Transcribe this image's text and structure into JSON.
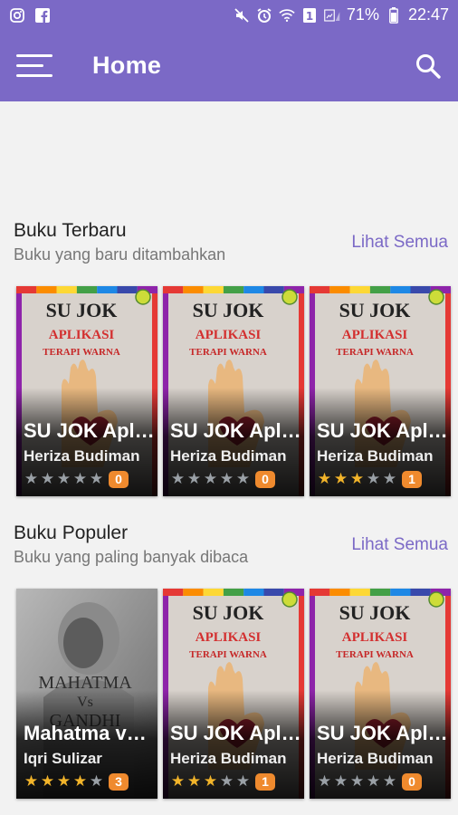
{
  "status_bar": {
    "battery": "71%",
    "time": "22:47",
    "icons": [
      "instagram-icon",
      "facebook-icon",
      "mute-icon",
      "alarm-icon",
      "wifi-icon",
      "sim1-icon",
      "signal-icon",
      "battery-icon"
    ]
  },
  "app_bar": {
    "title": "Home"
  },
  "sections": [
    {
      "title": "Buku Terbaru",
      "subtitle": "Buku yang baru ditambahkan",
      "see_all": "Lihat Semua",
      "books": [
        {
          "title": "SU JOK Aplikasi Terapi Warna",
          "author": "Heriza Budiman",
          "cover": "sujok",
          "rating": 0,
          "count": "0"
        },
        {
          "title": "SU JOK Aplikasi Terapi Warna",
          "author": "Heriza Budiman",
          "cover": "sujok",
          "rating": 0,
          "count": "0"
        },
        {
          "title": "SU JOK Aplikasi Terapi Warna",
          "author": "Heriza Budiman",
          "cover": "sujok",
          "rating": 3,
          "count": "1"
        }
      ]
    },
    {
      "title": "Buku Populer",
      "subtitle": "Buku yang paling banyak dibaca",
      "see_all": "Lihat Semua",
      "books": [
        {
          "title": "Mahatma vs Gandhi",
          "author": "Iqri Sulizar",
          "cover": "gandhi",
          "rating": 4,
          "count": "3"
        },
        {
          "title": "SU JOK Aplikasi Terapi Warna",
          "author": "Heriza Budiman",
          "cover": "sujok",
          "rating": 3,
          "count": "1"
        },
        {
          "title": "SU JOK Aplikasi Terapi Warna",
          "author": "Heriza Budiman",
          "cover": "sujok",
          "rating": 0,
          "count": "0"
        }
      ]
    }
  ],
  "covers": {
    "sujok": {
      "line1": "SU JOK",
      "line2": "APLIKASI",
      "line3": "TERAPI WARNA"
    },
    "gandhi": {
      "line1": "MAHATMA",
      "line2": "Vs",
      "line3": "GANDHI"
    }
  },
  "colors": {
    "primary": "#7b69c6",
    "star_on": "#f2b42a",
    "badge": "#ef8a2e"
  }
}
